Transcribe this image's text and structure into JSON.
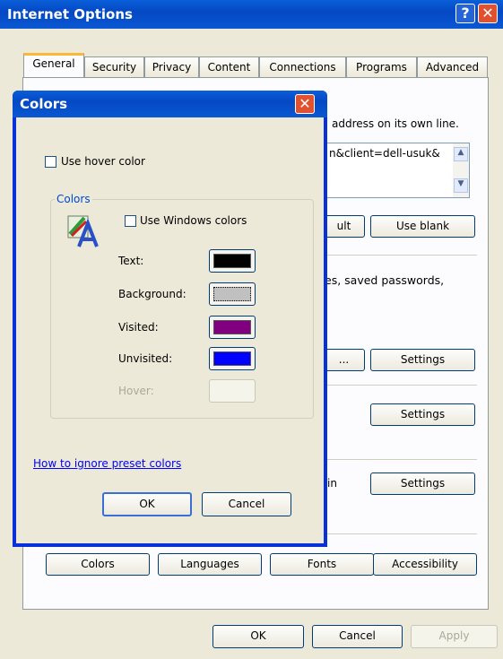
{
  "main_window": {
    "title": "Internet Options",
    "tabs": [
      "General",
      "Security",
      "Privacy",
      "Content",
      "Connections",
      "Programs",
      "Advanced"
    ],
    "partial_texts": {
      "address_line": "address on its own line.",
      "url_fragment": "n&client=dell-usuk&",
      "default_btn": "ult",
      "saved_pw": "es, saved passwords,",
      "ellipsis_btn": "...",
      "in_text": "in"
    },
    "buttons": {
      "use_blank": "Use blank",
      "settings": "Settings",
      "colors": "Colors",
      "languages": "Languages",
      "fonts": "Fonts",
      "accessibility": "Accessibility",
      "ok": "OK",
      "cancel": "Cancel",
      "apply": "Apply"
    }
  },
  "colors_dialog": {
    "title": "Colors",
    "use_hover_label": "Use hover color",
    "group_label": "Colors",
    "use_windows_label": "Use Windows colors",
    "rows": [
      {
        "label": "Text:",
        "color": "#000000"
      },
      {
        "label": "Background:",
        "color": "#c0c0c0"
      },
      {
        "label": "Visited:",
        "color": "#800080"
      },
      {
        "label": "Unvisited:",
        "color": "#0000ff"
      },
      {
        "label": "Hover:",
        "color": "#ece9d8"
      }
    ],
    "link": "How to ignore preset colors",
    "ok": "OK",
    "cancel": "Cancel"
  }
}
